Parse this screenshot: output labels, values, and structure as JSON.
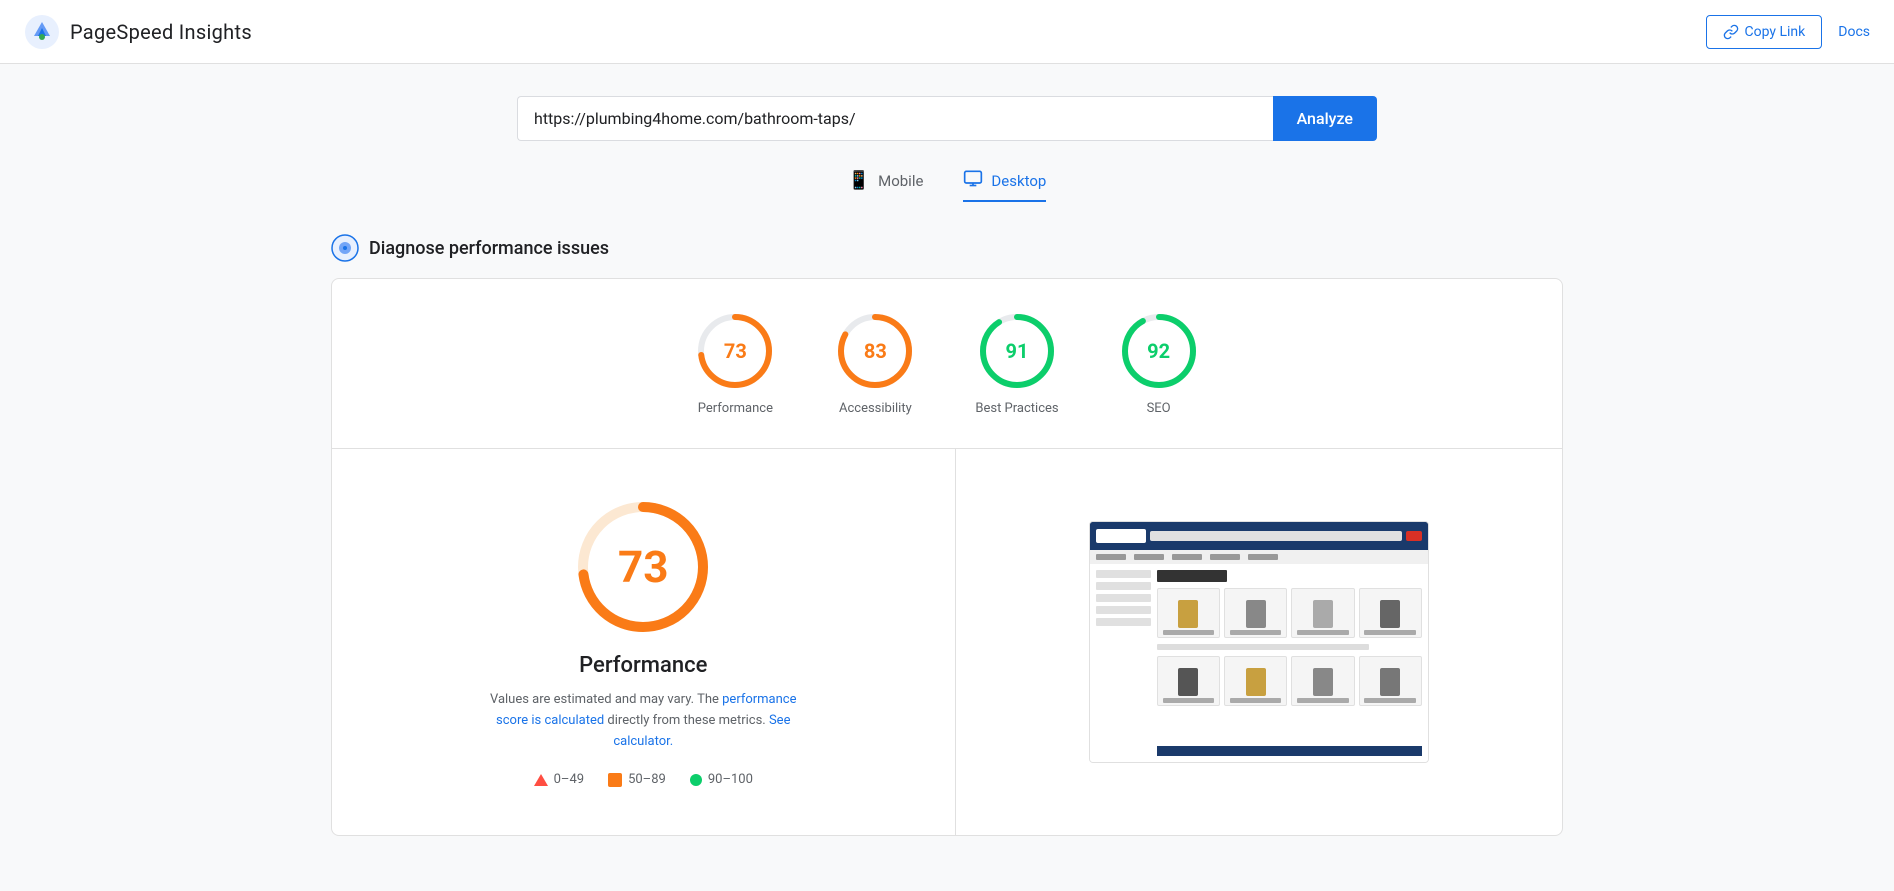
{
  "header": {
    "title": "PageSpeed Insights",
    "copy_link_label": "Copy Link",
    "docs_label": "Docs"
  },
  "url_bar": {
    "value": "https://plumbing4home.com/bathroom-taps/",
    "placeholder": "Enter a web page URL",
    "analyze_label": "Analyze"
  },
  "tabs": [
    {
      "id": "mobile",
      "label": "Mobile",
      "active": false
    },
    {
      "id": "desktop",
      "label": "Desktop",
      "active": true
    }
  ],
  "diagnose": {
    "title": "Diagnose performance issues"
  },
  "scores": [
    {
      "id": "performance",
      "value": 73,
      "label": "Performance",
      "color": "orange",
      "percent": 73
    },
    {
      "id": "accessibility",
      "value": 83,
      "label": "Accessibility",
      "color": "orange",
      "percent": 83
    },
    {
      "id": "best-practices",
      "value": 91,
      "label": "Best Practices",
      "color": "green",
      "percent": 91
    },
    {
      "id": "seo",
      "value": 92,
      "label": "SEO",
      "color": "green",
      "percent": 92
    }
  ],
  "detail": {
    "score": 73,
    "title": "Performance",
    "description_start": "Values are estimated and may vary. The",
    "description_link1": "performance score is calculated",
    "description_link2": "directly from these metrics.",
    "description_link3": "See calculator.",
    "legend": [
      {
        "id": "fail",
        "range": "0–49",
        "type": "triangle"
      },
      {
        "id": "average",
        "range": "50–89",
        "type": "square"
      },
      {
        "id": "pass",
        "range": "90–100",
        "type": "circle"
      }
    ]
  }
}
